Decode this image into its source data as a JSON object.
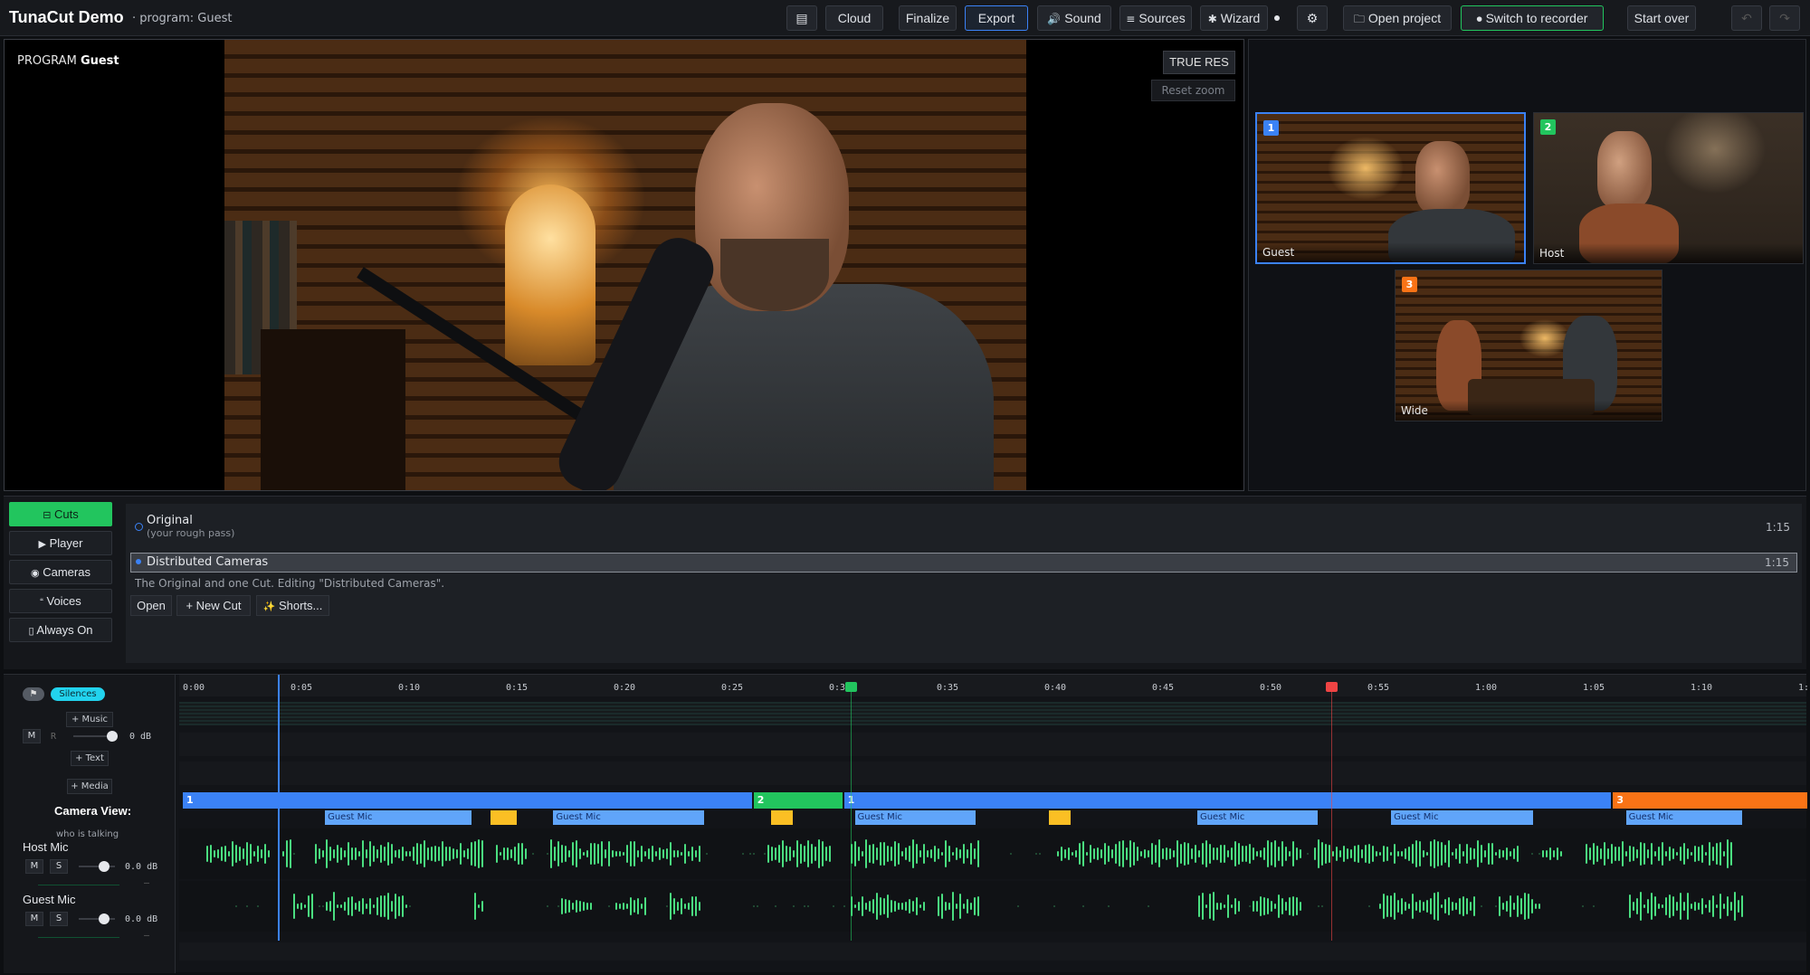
{
  "app": {
    "title": "TunaCut Demo",
    "program_label": "program: Guest"
  },
  "toolbar": {
    "menu_icon": "list-icon",
    "cloud": "Cloud",
    "finalize": "Finalize",
    "export": "Export",
    "sound": "Sound",
    "sources": "Sources",
    "wizard": "Wizard",
    "settings_icon": "gear-icon",
    "open_project": "Open project",
    "switch_recorder": "Switch to recorder",
    "start_over": "Start over",
    "undo_icon": "undo-icon",
    "redo_icon": "redo-icon"
  },
  "program": {
    "prefix": "PROGRAM",
    "camera": "Guest",
    "true_res": "TRUE RES",
    "reset_zoom": "Reset zoom"
  },
  "cameras": [
    {
      "num": "1",
      "label": "Guest",
      "color": "#3b82f6",
      "selected": true
    },
    {
      "num": "2",
      "label": "Host",
      "color": "#22c55e",
      "selected": false
    },
    {
      "num": "3",
      "label": "Wide",
      "color": "#f97316",
      "selected": false
    }
  ],
  "sidebar": {
    "cuts": "Cuts",
    "player": "Player",
    "cameras": "Cameras",
    "voices": "Voices",
    "always_on": "Always On"
  },
  "cuts": {
    "items": [
      {
        "name": "Original",
        "sub": "(your rough pass)",
        "duration": "1:15"
      },
      {
        "name": "Distributed Cameras",
        "duration": "1:15"
      }
    ],
    "info": "The Original and one Cut. Editing \"Distributed Cameras\".",
    "open": "Open",
    "new_cut": "+ New Cut",
    "shorts": "Shorts..."
  },
  "timeline": {
    "silences": "Silences",
    "music": "+ Music",
    "text": "+ Text",
    "media": "+ Media",
    "camera_view": "Camera View:",
    "who_talking": "who is talking",
    "music_db": "0 dB",
    "host_mic": "Host Mic",
    "host_db": "0.0 dB",
    "guest_mic": "Guest Mic",
    "guest_db": "0.0 dB",
    "mute": "M",
    "solo": "S",
    "rec": "R",
    "dash": "—",
    "ticks": [
      "0:00",
      "0:05",
      "0:10",
      "0:15",
      "0:20",
      "0:25",
      "0:30",
      "0:35",
      "0:40",
      "0:45",
      "0:50",
      "0:55",
      "1:00",
      "1:05",
      "1:10",
      "1:"
    ],
    "camera_segments": [
      {
        "cam": "1",
        "start": 0,
        "end": 26.5,
        "color": "#3b82f6"
      },
      {
        "cam": "2",
        "start": 26.5,
        "end": 30.7,
        "color": "#22c55e"
      },
      {
        "cam": "1",
        "start": 30.7,
        "end": 66.4,
        "color": "#3b82f6"
      },
      {
        "cam": "3",
        "start": 66.4,
        "end": 75.5,
        "color": "#f97316"
      }
    ],
    "speaker_segments": [
      {
        "label": "Guest Mic",
        "start": 6.6,
        "end": 13.4,
        "color": "#60a5fa"
      },
      {
        "label": "",
        "start": 14.3,
        "end": 15.5,
        "color": "#fbbf24"
      },
      {
        "label": "Guest Mic",
        "start": 17.2,
        "end": 24.2,
        "color": "#60a5fa"
      },
      {
        "label": "",
        "start": 27.3,
        "end": 28.3,
        "color": "#fbbf24"
      },
      {
        "label": "Guest Mic",
        "start": 31.2,
        "end": 36.8,
        "color": "#60a5fa"
      },
      {
        "label": "",
        "start": 40.2,
        "end": 41.2,
        "color": "#fbbf24"
      },
      {
        "label": "Guest Mic",
        "start": 47.1,
        "end": 52.7,
        "color": "#60a5fa"
      },
      {
        "label": "Guest Mic",
        "start": 56.1,
        "end": 62.7,
        "color": "#60a5fa"
      },
      {
        "label": "Guest Mic",
        "start": 67.0,
        "end": 72.4,
        "color": "#60a5fa"
      }
    ],
    "playhead": 4.4,
    "markers": [
      {
        "time": 31.0,
        "color": "#22c55e"
      },
      {
        "time": 53.3,
        "color": "#ef4444"
      }
    ]
  }
}
